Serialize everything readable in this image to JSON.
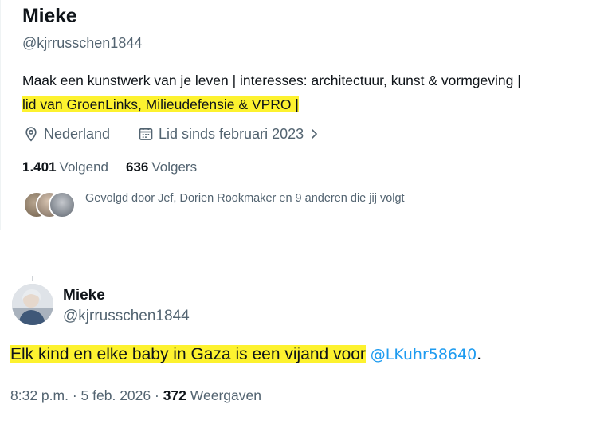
{
  "profile": {
    "name": "Mieke",
    "handle": "@kjrrusschen1844",
    "bio_line1": "Maak een kunstwerk van je leven | interesses: architectuur, kunst & vormgeving |",
    "bio_line2": "lid van GroenLinks, Milieudefensie & VPRO |",
    "location": "Nederland",
    "joined": "Lid sinds februari 2023",
    "following_count": "1.401",
    "following_label": "Volgend",
    "followers_count": "636",
    "followers_label": "Volgers",
    "followed_by": "Gevolgd door Jef, Dorien Rookmaker en 9 anderen die jij volgt"
  },
  "tweet": {
    "name": "Mieke",
    "handle": "@kjrrusschen1844",
    "text": "Elk kind en elke baby in Gaza is een vijand voor",
    "mention": "@LKuhr58640",
    "text_end": ".",
    "time": "8:32 p.m.",
    "sep1": "·",
    "date": "5 feb. 2026",
    "sep2": "·",
    "views_count": "372",
    "views_label": "Weergaven"
  },
  "colors": {
    "highlight": "#fdf22f",
    "link": "#1d9bf0",
    "secondary_text": "#536471"
  },
  "icons": [
    "location-icon",
    "calendar-icon",
    "chevron-right-icon"
  ]
}
